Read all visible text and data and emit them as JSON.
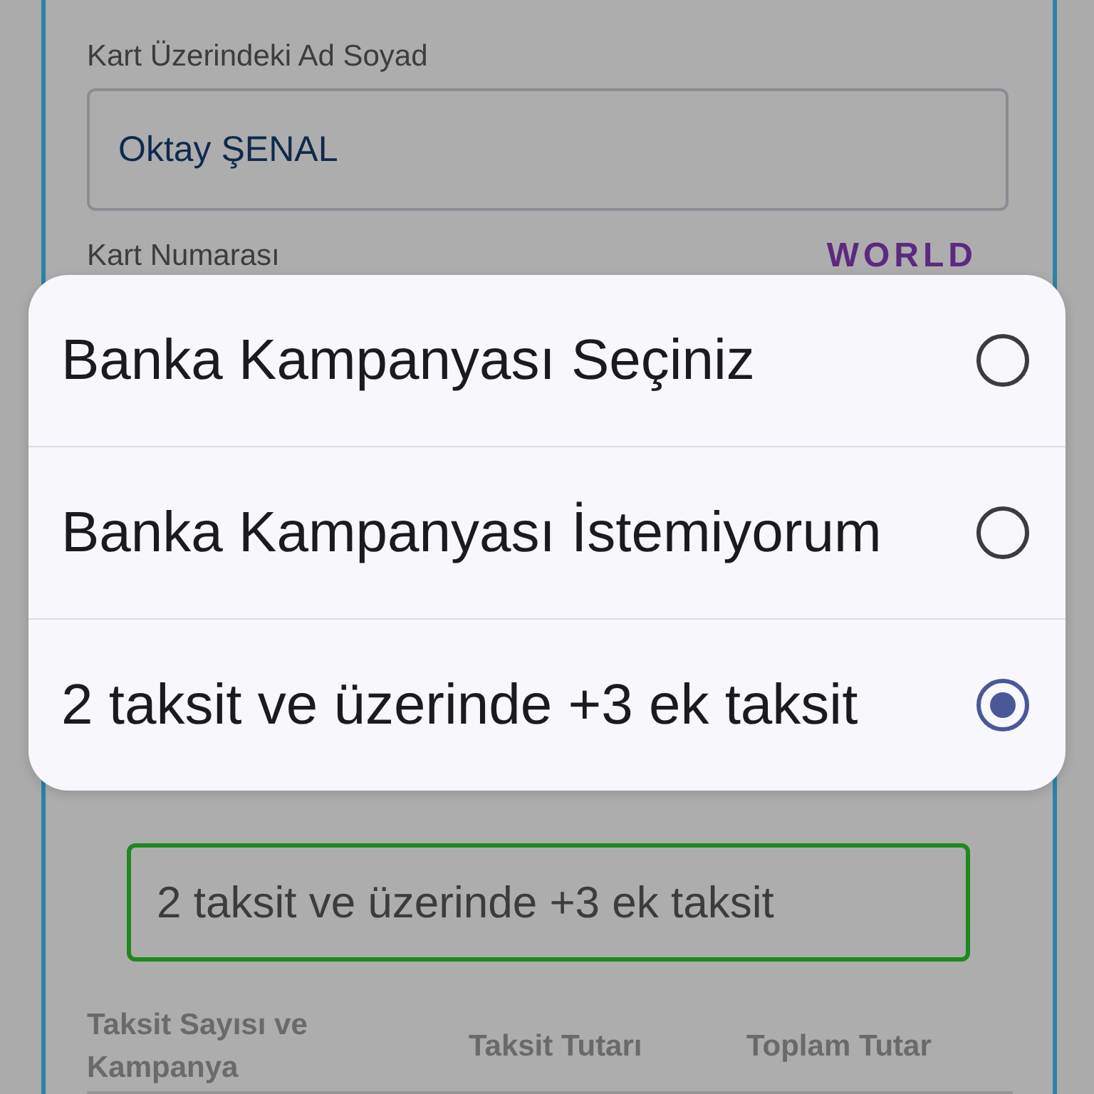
{
  "form": {
    "name_label": "Kart Üzerindeki Ad Soyad",
    "name_value": "Oktay ŞENAL",
    "card_number_label": "Kart Numarası",
    "card_brand": "WORLD"
  },
  "campaign_select": {
    "value": "2 taksit ve üzerinde +3 ek taksit"
  },
  "installment_table": {
    "columns": [
      "Taksit Sayısı ve Kampanya",
      "Taksit Tutarı",
      "Toplam Tutar"
    ]
  },
  "dialog": {
    "options": [
      {
        "label": "Banka Kampanyası Seçiniz",
        "selected": false
      },
      {
        "label": "Banka Kampanyası İstemiyorum",
        "selected": false
      },
      {
        "label": "2 taksit ve üzerinde +3 ek taksit",
        "selected": true
      }
    ]
  }
}
